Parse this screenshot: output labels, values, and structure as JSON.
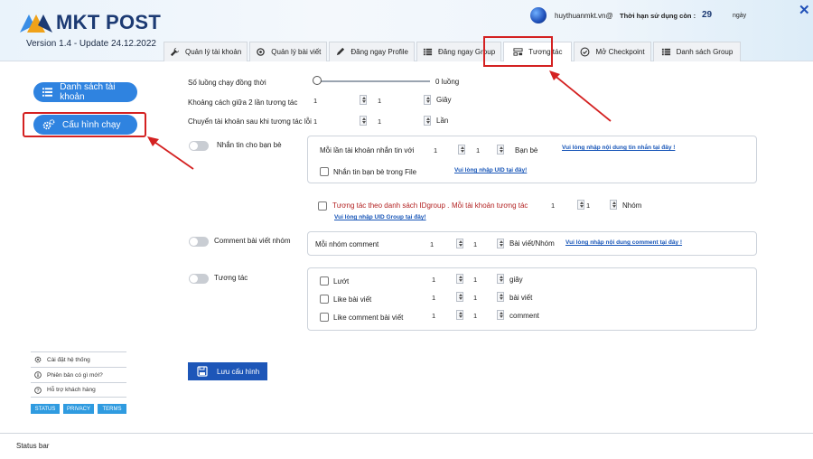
{
  "app": {
    "name": "MKT POST",
    "version": "Version 1.4 - Update 24.12.2022",
    "brand_color": "#1c3a73",
    "accent_color": "#2f83e0"
  },
  "user": {
    "email": "huythuanmkt.vn@",
    "expiry_label": "Thời hạn sử dụng còn :",
    "expiry_days": "29",
    "expiry_unit": "ngày"
  },
  "tabs": [
    {
      "label": "Quản lý tài khoản",
      "icon": "wrench-icon"
    },
    {
      "label": "Quản lý bài viết",
      "icon": "refresh-icon"
    },
    {
      "label": "Đăng ngay Profile",
      "icon": "pen-icon"
    },
    {
      "label": "Đăng ngay Group",
      "icon": "list-icon"
    },
    {
      "label": "Tương tác",
      "icon": "interact-icon",
      "active": true
    },
    {
      "label": "Mở Checkpoint",
      "icon": "check-circle-icon"
    },
    {
      "label": "Danh sách Group",
      "icon": "list-icon"
    }
  ],
  "sidebar": {
    "account_list": "Danh sách tài khoản",
    "run_config": "Cấu hình chạy",
    "links": [
      {
        "label": "Cài đặt hệ thống",
        "icon": "gear-icon"
      },
      {
        "label": "Phiên bản có gì mới?",
        "icon": "info-icon"
      },
      {
        "label": "Hỗ trợ khách hàng",
        "icon": "help-icon"
      }
    ],
    "mini_buttons": [
      "STATUS",
      "PRIVACY",
      "TERMS"
    ]
  },
  "form": {
    "threads_label": "Số luồng chạy đồng thời",
    "threads_value": "0 luồng",
    "interval_label": "Khoảng cách giữa 2 lần tương tác",
    "interval_from": "1",
    "interval_to": "1",
    "interval_unit": "Giây",
    "switch_label": "Chuyển tài khoản sau khi tương tác lỗi",
    "switch_from": "1",
    "switch_to": "1",
    "switch_unit": "Lần",
    "friends_msg": {
      "toggle_label": "Nhắn tin cho bạn bè",
      "per_account_label": "Mỗi lần tài khoản nhắn tin với",
      "from": "1",
      "to": "1",
      "unit": "Bạn bè",
      "content_link": "Vui lòng nhập nội dung tin nhắn tại đây !",
      "file_label": "Nhắn tin bạn bè trong File",
      "uid_link": "Vui lòng nhập  UID tại đây!"
    },
    "idgroup": {
      "label": "Tương tác theo danh sách IDgroup .",
      "per_account_label": "Mỗi tài khoản tương tác",
      "from": "1",
      "to": "1",
      "unit": "Nhóm",
      "uid_link": "Vui lòng nhập UID Group tại đây!"
    },
    "group_comment": {
      "toggle_label": "Comment bài viết nhóm",
      "per_group_label": "Mỗi nhóm comment",
      "from": "1",
      "to": "1",
      "unit": "Bài viết/Nhóm",
      "content_link": "Vui lòng nhập nội dung comment tại đây !"
    },
    "interaction": {
      "toggle_label": "Tương tác",
      "rows": [
        {
          "label": "Lướt",
          "from": "1",
          "to": "1",
          "unit": "giây"
        },
        {
          "label": "Like bài viết",
          "from": "1",
          "to": "1",
          "unit": "bài viết"
        },
        {
          "label": "Like comment bài viết",
          "from": "1",
          "to": "1",
          "unit": "comment"
        }
      ]
    },
    "save_label": "Lưu cấu hình"
  },
  "status_bar": "Status bar"
}
